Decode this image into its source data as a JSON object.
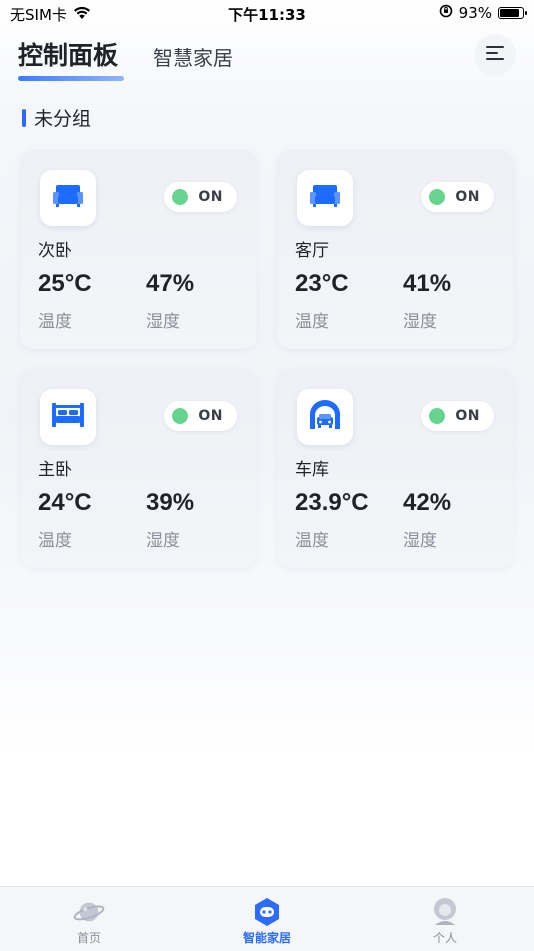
{
  "status_bar": {
    "carrier": "无SIM卡",
    "time": "下午11:33",
    "battery": "93%",
    "battery_level": 0.93
  },
  "header": {
    "tabs": [
      {
        "label": "控制面板",
        "active": true
      },
      {
        "label": "智慧家居",
        "active": false
      }
    ]
  },
  "section": {
    "title": "未分组"
  },
  "rooms": [
    {
      "name": "次卧",
      "status": "ON",
      "temperature": "25°C",
      "humidity": "47%",
      "temp_label": "温度",
      "hum_label": "湿度",
      "icon": "sofa-icon"
    },
    {
      "name": "客厅",
      "status": "ON",
      "temperature": "23°C",
      "humidity": "41%",
      "temp_label": "温度",
      "hum_label": "湿度",
      "icon": "sofa-icon"
    },
    {
      "name": "主卧",
      "status": "ON",
      "temperature": "24°C",
      "humidity": "39%",
      "temp_label": "温度",
      "hum_label": "湿度",
      "icon": "bed-icon"
    },
    {
      "name": "车库",
      "status": "ON",
      "temperature": "23.9°C",
      "humidity": "42%",
      "temp_label": "温度",
      "hum_label": "湿度",
      "icon": "garage-icon"
    }
  ],
  "tabbar": {
    "items": [
      {
        "label": "首页",
        "icon": "planet-icon",
        "active": false
      },
      {
        "label": "智能家居",
        "icon": "robot-icon",
        "active": true
      },
      {
        "label": "个人",
        "icon": "user-icon",
        "active": false
      }
    ]
  },
  "colors": {
    "accent": "#2b6cff",
    "on_dot": "#66d48f",
    "icon_blue": "#1e6bff"
  }
}
